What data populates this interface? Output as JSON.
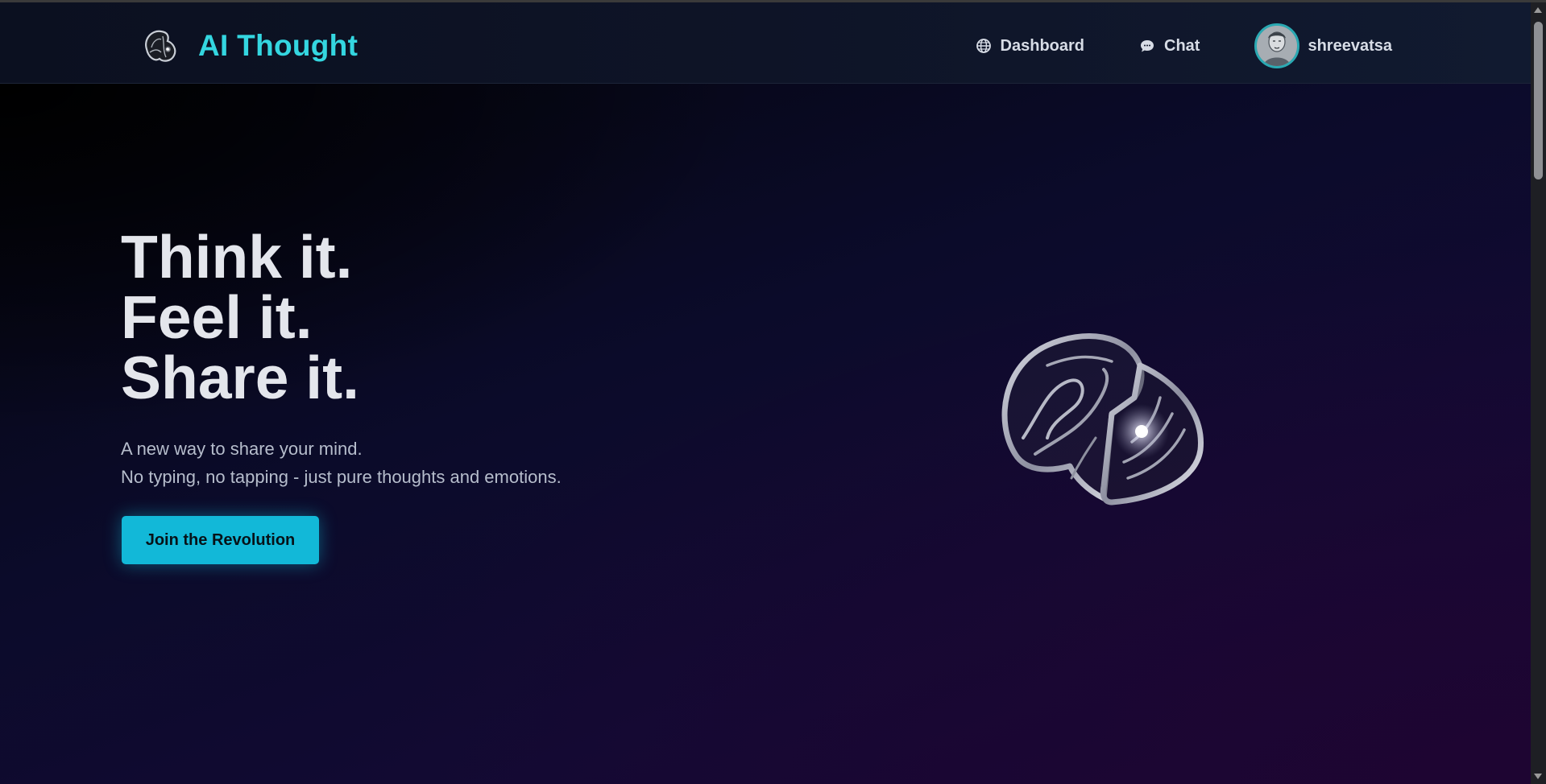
{
  "header": {
    "brand_title": "AI Thought",
    "brand_icon": "brain-logo-icon",
    "nav": [
      {
        "label": "Dashboard",
        "icon": "globe-icon"
      },
      {
        "label": "Chat",
        "icon": "chat-bubble-icon"
      }
    ],
    "user": {
      "name": "shreevatsa",
      "avatar_icon": "avatar"
    }
  },
  "hero": {
    "headline": [
      "Think it.",
      "Feel it.",
      "Share it."
    ],
    "subtext": [
      "A new way to share your mind.",
      "No typing, no tapping - just pure thoughts and emotions."
    ],
    "cta_label": "Join the Revolution",
    "illustration_icon": "brain-illustration-icon"
  },
  "colors": {
    "accent": "#34d6e0",
    "button": "#12b8d8",
    "background_start": "#04050d",
    "background_end": "#1a0636",
    "text": "#e4e6ec"
  }
}
